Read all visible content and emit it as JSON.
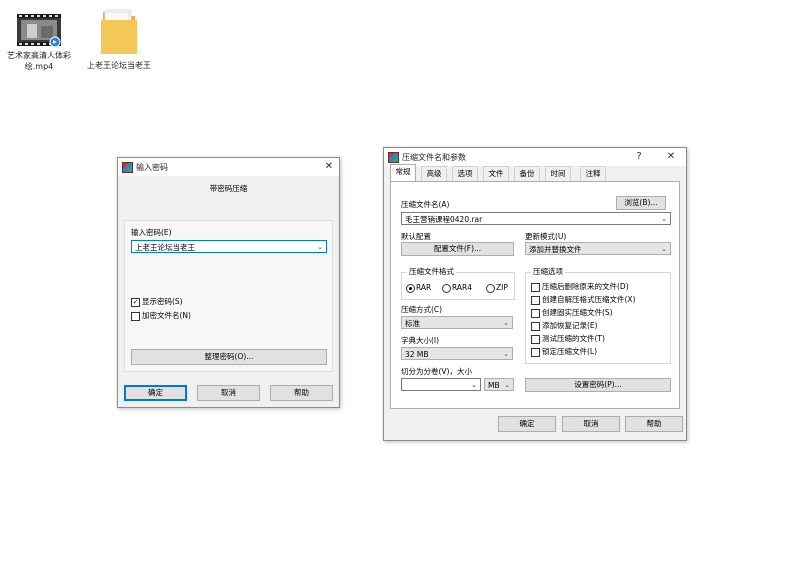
{
  "desktop": {
    "items": [
      {
        "name": "艺术家高清人体彩绘.mp4"
      },
      {
        "name": "上老王论坛当老王"
      }
    ]
  },
  "password_dialog": {
    "title": "输入密码",
    "heading": "带密码压缩",
    "password_label": "输入密码(E)",
    "password_value": "上老王论坛当老王",
    "show_password": "显示密码(S)",
    "show_password_checked": true,
    "encrypt_filenames": "加密文件名(N)",
    "encrypt_filenames_checked": false,
    "organize_button": "整理密码(O)...",
    "ok": "确定",
    "cancel": "取消",
    "help": "帮助",
    "close_glyph": "✕"
  },
  "archive_dialog": {
    "title": "压缩文件名和参数",
    "help_glyph": "?",
    "close_glyph": "✕",
    "tabs": [
      "常规",
      "高级",
      "选项",
      "文件",
      "备份",
      "时间",
      "注释"
    ],
    "active_tab": 0,
    "archive_name_label": "压缩文件名(A)",
    "browse_button": "浏览(B)...",
    "archive_name_value": "毛王营销课程0420.rar",
    "default_profile_label": "默认配置",
    "profile_button": "配置文件(F)...",
    "update_mode_label": "更新模式(U)",
    "update_mode_value": "添加并替换文件",
    "format_group": "压缩文件格式",
    "formats": [
      {
        "label": "RAR",
        "selected": true
      },
      {
        "label": "RAR4",
        "selected": false
      },
      {
        "label": "ZIP",
        "selected": false
      }
    ],
    "method_label": "压缩方式(C)",
    "method_value": "标准",
    "dict_label": "字典大小(I)",
    "dict_value": "32 MB",
    "split_label": "切分为分卷(V)，大小",
    "split_value": "",
    "split_unit": "MB",
    "options_group": "压缩选项",
    "options": [
      {
        "label": "压缩后删除原来的文件(D)",
        "checked": false
      },
      {
        "label": "创建自解压格式压缩文件(X)",
        "checked": false
      },
      {
        "label": "创建固实压缩文件(S)",
        "checked": false
      },
      {
        "label": "添加恢复记录(E)",
        "checked": false
      },
      {
        "label": "测试压缩的文件(T)",
        "checked": false
      },
      {
        "label": "锁定压缩文件(L)",
        "checked": false
      }
    ],
    "set_password_button": "设置密码(P)...",
    "ok": "确定",
    "cancel": "取消",
    "help": "帮助"
  },
  "colors": {
    "accent": "#0078d7",
    "dialog_bg": "#f0f0f0",
    "folder": "#f3c758"
  }
}
